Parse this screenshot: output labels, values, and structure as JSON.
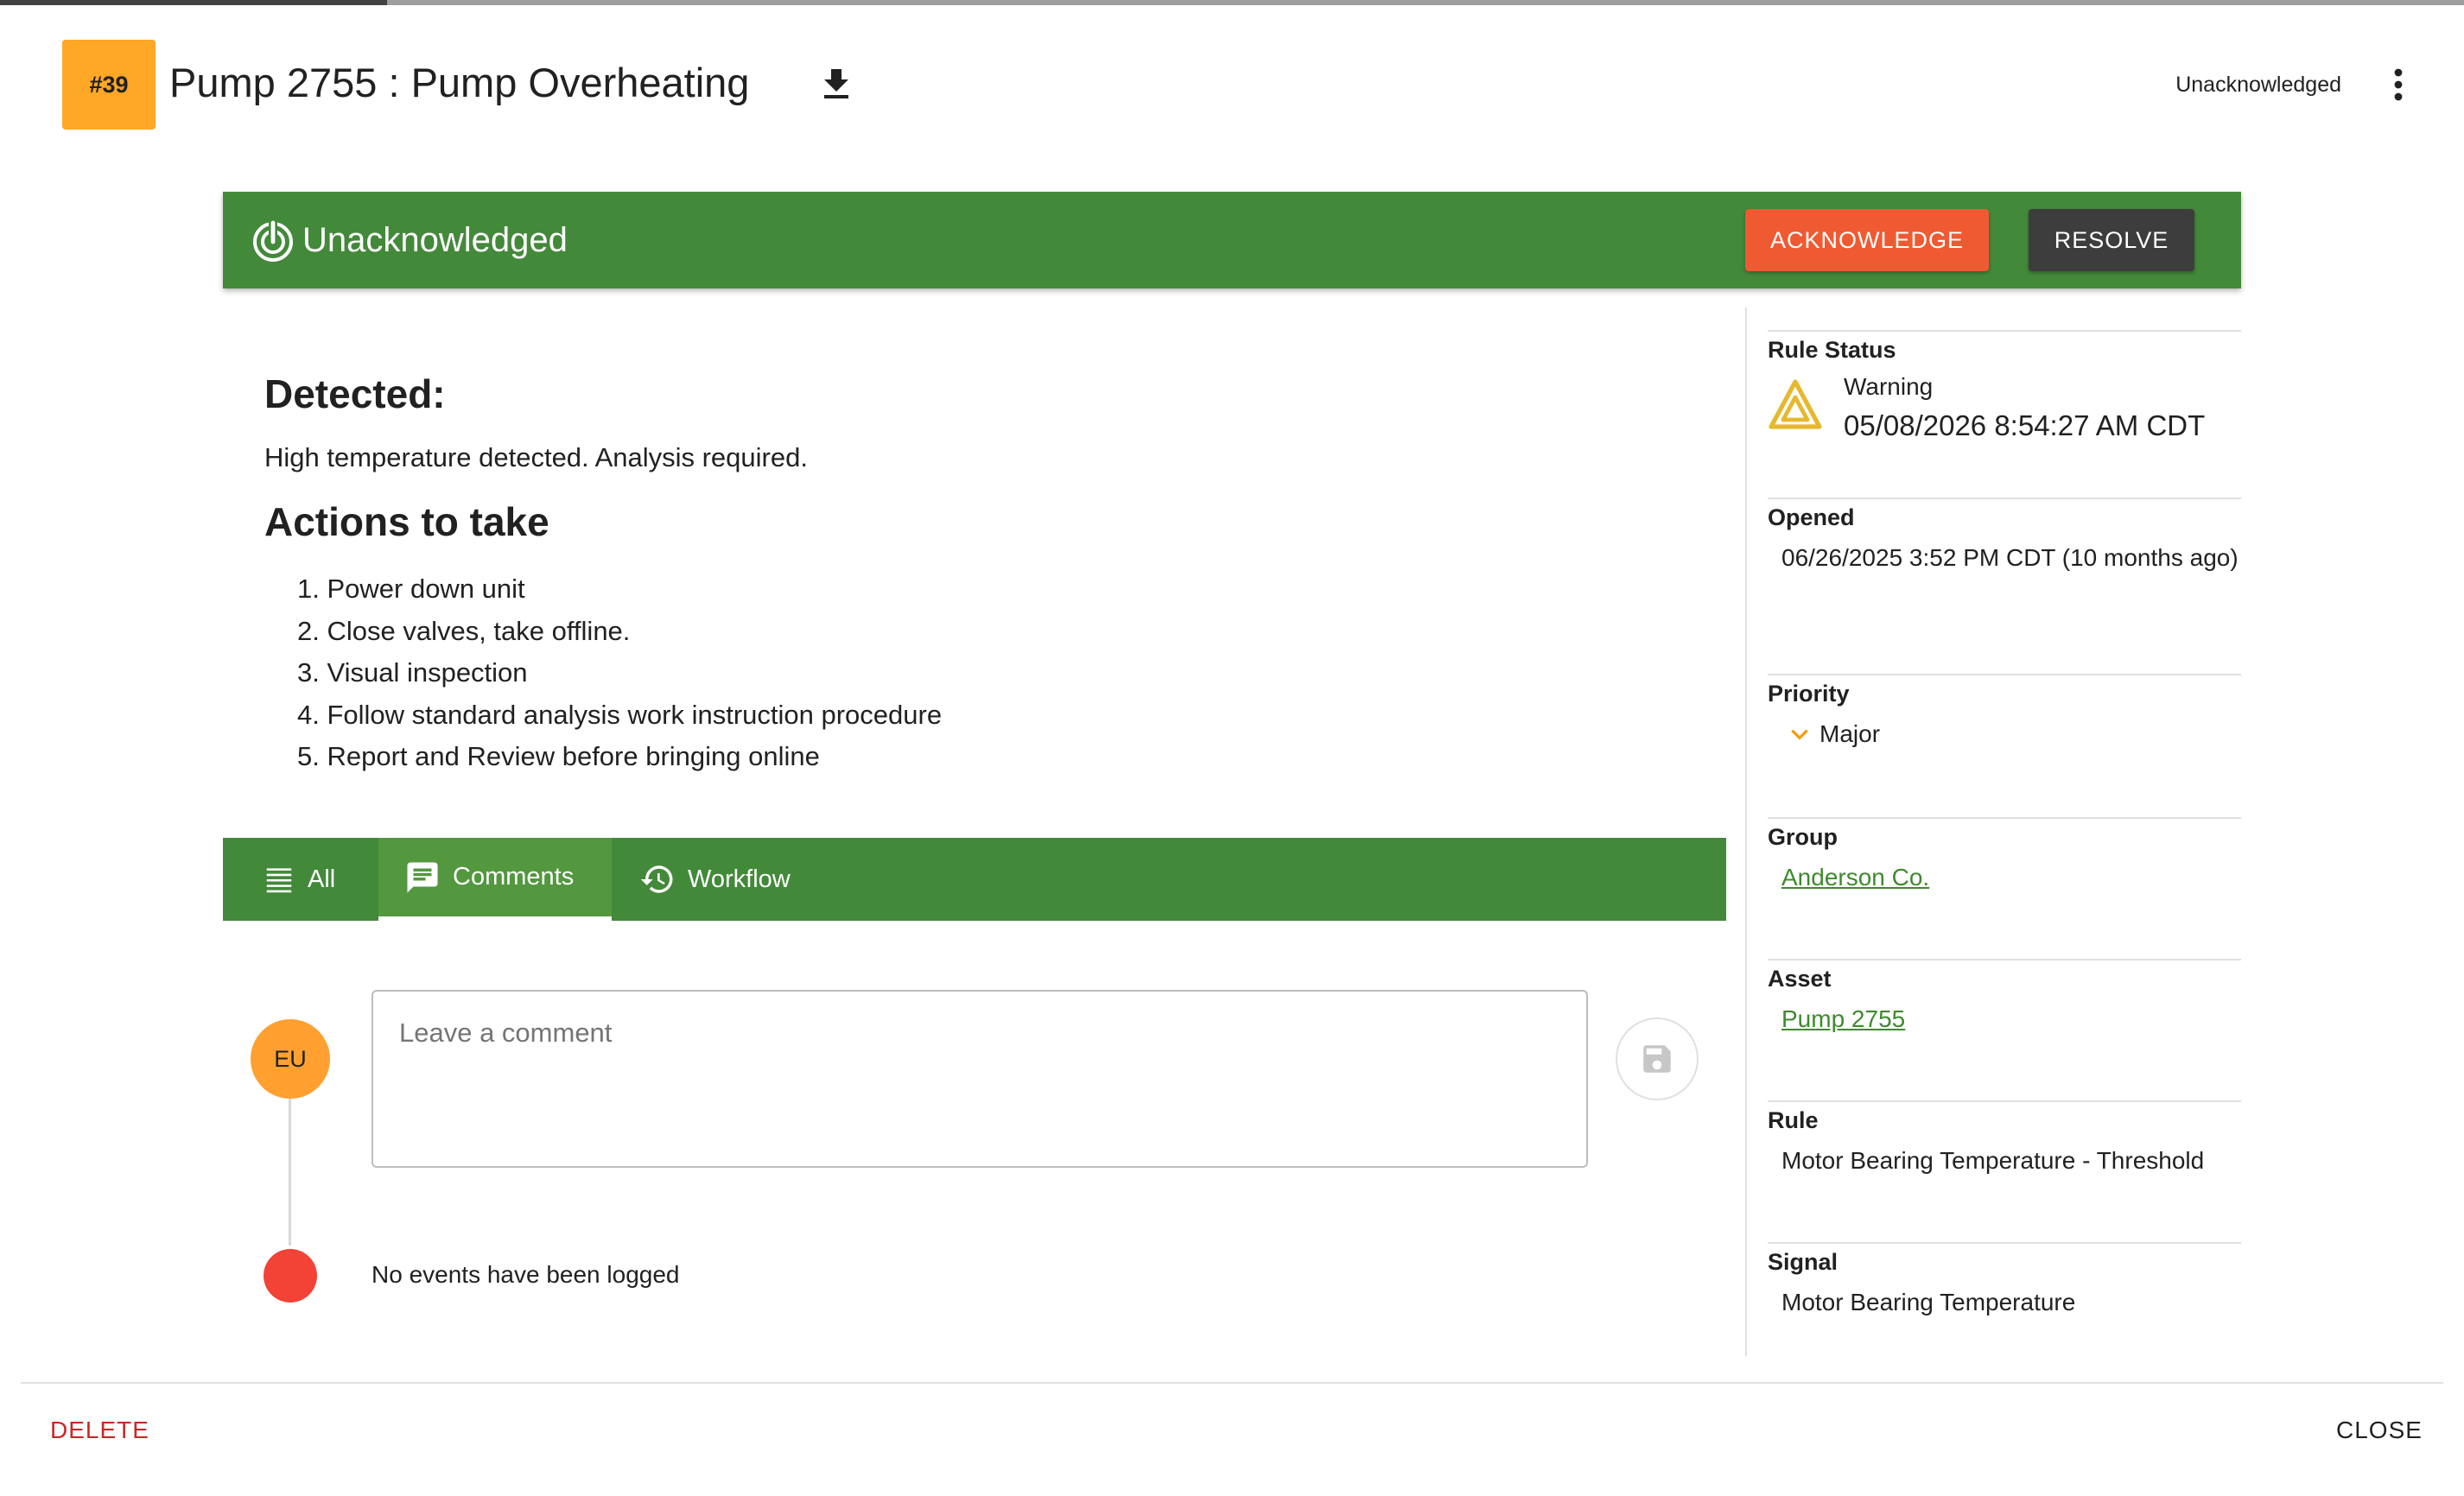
{
  "header": {
    "id_badge": "#39",
    "title": "Pump 2755 : Pump Overheating",
    "status": "Unacknowledged",
    "icons": {
      "download": "download-icon",
      "more": "more-vert-icon"
    }
  },
  "banner": {
    "status": "Unacknowledged",
    "icon": "touch-icon",
    "acknowledge_label": "ACKNOWLEDGE",
    "resolve_label": "RESOLVE"
  },
  "description": {
    "detected_heading": "Detected:",
    "detected_text": "High temperature detected. Analysis required.",
    "actions_heading": "Actions to take",
    "actions": [
      "1. Power down unit",
      "2. Close valves, take offline.",
      "3. Visual inspection",
      "4. Follow standard analysis work instruction procedure",
      "5. Report and Review before bringing online"
    ]
  },
  "tabs": [
    {
      "label": "All",
      "icon": "list-icon"
    },
    {
      "label": "Comments",
      "icon": "comment-icon",
      "active": true
    },
    {
      "label": "Workflow",
      "icon": "history-icon"
    }
  ],
  "comments": {
    "avatar": "EU",
    "placeholder": "Leave a comment",
    "save_icon": "save-icon",
    "empty_text": "No events have been logged"
  },
  "details": {
    "rule_status": {
      "label": "Rule Status",
      "value": "Warning",
      "timestamp": "05/08/2026 8:54:27 AM CDT",
      "icon": "warning-icon"
    },
    "opened": {
      "label": "Opened",
      "value": "06/26/2025 3:52 PM CDT (10 months ago)"
    },
    "priority": {
      "label": "Priority",
      "value": "Major",
      "icon": "chevron-down-icon"
    },
    "group": {
      "label": "Group",
      "value": "Anderson Co."
    },
    "asset": {
      "label": "Asset",
      "value": "Pump 2755"
    },
    "rule": {
      "label": "Rule",
      "value": "Motor Bearing Temperature - Threshold"
    },
    "signal": {
      "label": "Signal",
      "value": "Motor Bearing Temperature"
    }
  },
  "footer": {
    "delete_label": "DELETE",
    "close_label": "CLOSE"
  },
  "colors": {
    "banner_green": "#43893a",
    "acknowledge_orange": "#f05a32",
    "resolve_dark": "#3d3d3d",
    "badge_orange": "#ffa726",
    "link_green": "#3f8a2e",
    "delete_red": "#c62828",
    "warning_yellow": "#e6b82e",
    "timeline_red": "#f24336"
  }
}
